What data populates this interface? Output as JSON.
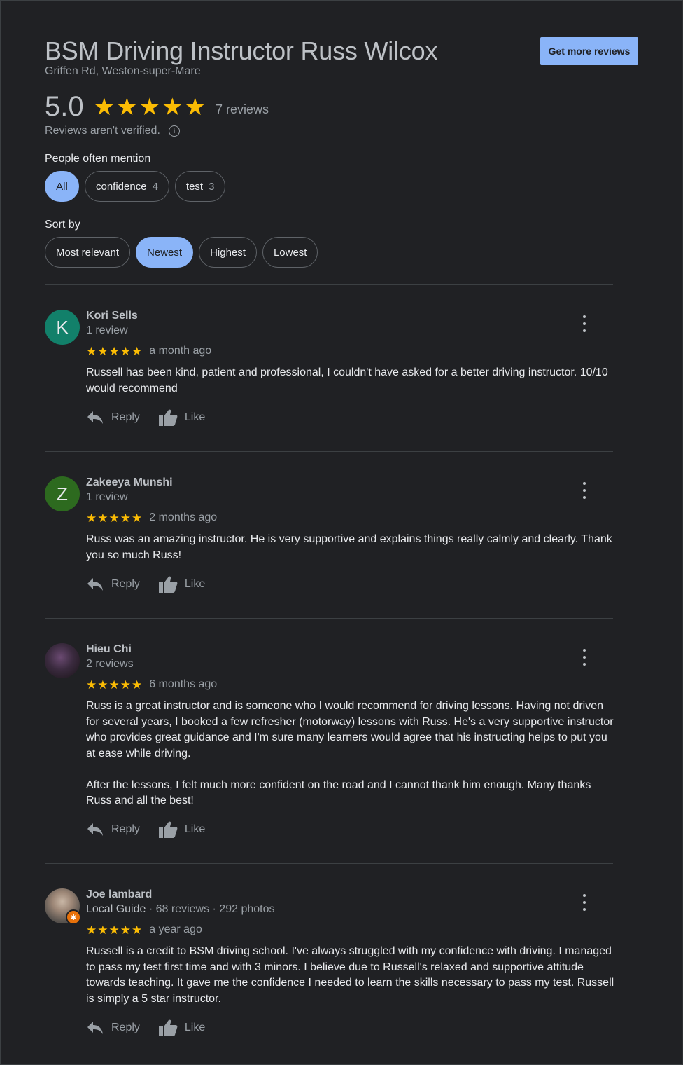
{
  "header": {
    "title": "BSM Driving Instructor Russ Wilcox",
    "address": "Griffen Rd, Weston-super-Mare",
    "get_more_label": "Get more reviews",
    "rating": "5.0",
    "stars": 5,
    "review_count": "7 reviews",
    "unverified": "Reviews aren't verified."
  },
  "mentions": {
    "label": "People often mention",
    "chips": [
      {
        "label": "All",
        "count": ""
      },
      {
        "label": "confidence",
        "count": "4"
      },
      {
        "label": "test",
        "count": "3"
      }
    ],
    "active": "All"
  },
  "sort": {
    "label": "Sort by",
    "options": [
      "Most relevant",
      "Newest",
      "Highest",
      "Lowest"
    ],
    "active": "Newest"
  },
  "colors": {
    "accent": "#8ab4f8",
    "star": "#fbbc04",
    "avatar_k": "#12806a",
    "avatar_z": "#2d6a1f"
  },
  "actions": {
    "reply": "Reply",
    "like": "Like"
  },
  "reviews": [
    {
      "name": "Kori Sells",
      "initial": "K",
      "meta": "1 review",
      "guide": "",
      "stars": 5,
      "when": "a month ago",
      "text": "Russell has been kind, patient and professional, I couldn't have asked for a better driving instructor. 10/10 would recommend"
    },
    {
      "name": "Zakeeya Munshi",
      "initial": "Z",
      "meta": "1 review",
      "guide": "",
      "stars": 5,
      "when": "2 months ago",
      "text": "Russ was an amazing instructor. He is very supportive and explains things really calmly and clearly. Thank you so much Russ!"
    },
    {
      "name": "Hieu Chi",
      "initial": "",
      "meta": "2 reviews",
      "guide": "",
      "stars": 5,
      "when": "6 months ago",
      "text": "Russ is a great instructor and is someone who I would recommend for driving lessons. Having not driven for several years, I booked a few refresher (motorway) lessons with Russ. He's a very supportive instructor who provides great guidance and I'm sure many learners would agree that his instructing helps to put you at ease while driving.\n\nAfter the lessons, I felt much more confident on the road and I cannot thank him enough. Many thanks Russ and all the best!"
    },
    {
      "name": "Joe lambard",
      "initial": "",
      "meta": " · 68 reviews · 292 photos",
      "guide": "Local Guide",
      "stars": 5,
      "when": "a year ago",
      "text": "Russell is a credit to BSM driving school. I've always struggled with my confidence with driving. I managed to pass my test first time and with 3 minors. I believe due to Russell's relaxed and supportive attitude towards teaching. It gave me the confidence I needed to learn the skills necessary to pass my test. Russell is simply a 5 star instructor."
    }
  ]
}
